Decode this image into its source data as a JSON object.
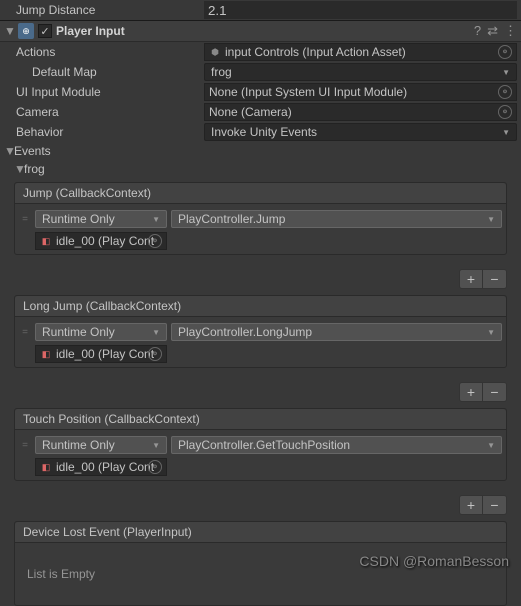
{
  "topProps": {
    "jumpDistance": {
      "label": "Jump Distance",
      "value": "2.1"
    }
  },
  "component": {
    "title": "Player Input",
    "enabled": true
  },
  "props": {
    "actions": {
      "label": "Actions",
      "value": "input Controls (Input Action Asset)"
    },
    "defaultMap": {
      "label": "Default Map",
      "value": "frog"
    },
    "uiInputModule": {
      "label": "UI Input Module",
      "value": "None (Input System UI Input Module)"
    },
    "camera": {
      "label": "Camera",
      "value": "None (Camera)"
    },
    "behavior": {
      "label": "Behavior",
      "value": "Invoke Unity Events"
    }
  },
  "eventsLabel": "Events",
  "mapLabel": "frog",
  "events": [
    {
      "title": "Jump (CallbackContext)",
      "runtime": "Runtime Only",
      "func": "PlayController.Jump",
      "target": "idle_00 (Play Cont"
    },
    {
      "title": "Long Jump (CallbackContext)",
      "runtime": "Runtime Only",
      "func": "PlayController.LongJump",
      "target": "idle_00 (Play Cont"
    },
    {
      "title": "Touch Position (CallbackContext)",
      "runtime": "Runtime Only",
      "func": "PlayController.GetTouchPosition",
      "target": "idle_00 (Play Cont"
    }
  ],
  "deviceLost": {
    "title": "Device Lost Event (PlayerInput)",
    "empty": "List is Empty"
  },
  "buttons": {
    "plus": "+",
    "minus": "−"
  },
  "watermark": "CSDN @RomanBesson"
}
